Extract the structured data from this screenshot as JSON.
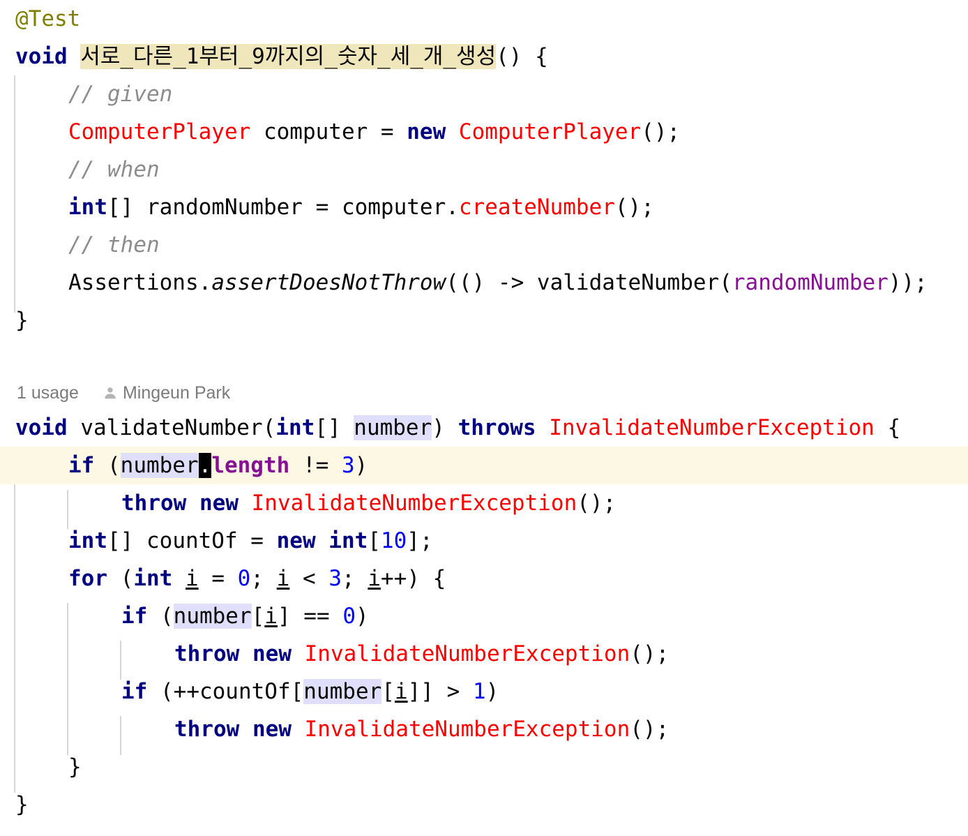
{
  "editor": {
    "language": "java",
    "theme": "IntelliJ Light",
    "colors": {
      "background": "#ffffff",
      "default_text": "#080808",
      "keyword": "#000080",
      "class_name": "#ff0000",
      "annotation": "#808000",
      "comment": "#8c8c8c",
      "number": "#0000ff",
      "instance_field": "#871094",
      "local_variable": "#871094",
      "caret_row_highlight": "#fdf8e3",
      "identifier_under_caret_highlight": "#dfdffb",
      "method_name_highlight": "#f0e6bc",
      "indent_guide": "#d7d7d7",
      "inlay_text": "#808080",
      "caret": "#000000"
    }
  },
  "code": {
    "line1": {
      "annotation": "@Test"
    },
    "line2": {
      "keyword_void": "void",
      "method_name": "서로_다른_1부터_9까지의_숫자_세_개_생성",
      "tail": "() {"
    },
    "line3": {
      "comment": "// given"
    },
    "line4": {
      "type": "ComputerPlayer",
      "var": " computer = ",
      "keyword_new": "new",
      "ctor": " ComputerPlayer",
      "tail": "();"
    },
    "line5": {
      "comment": "// when"
    },
    "line6": {
      "keyword_int": "int",
      "mid": "[] randomNumber = computer.",
      "method_call": "createNumber",
      "tail": "();"
    },
    "line7": {
      "comment": "// then"
    },
    "line8": {
      "head": "Assertions.",
      "static_method": "assertDoesNotThrow",
      "mid": "(() -> validateNumber(",
      "arg": "randomNumber",
      "tail": "));"
    },
    "line9": {
      "brace": "}"
    },
    "inlay": {
      "usages": "1 usage",
      "author": "Mingeun Park",
      "icon": "person-icon"
    },
    "line10": {
      "keyword_void": "void",
      "method_name": " validateNumber(",
      "keyword_int": "int",
      "brackets": "[] ",
      "param": "number",
      "mid": ") ",
      "keyword_throws": "throws",
      "exception": " InvalidateNumberException",
      "tail": " {"
    },
    "line11": {
      "keyword_if": "if",
      "open": " (",
      "ident": "number",
      "caret_char": ".",
      "field": "length",
      "op": " != ",
      "number": "3",
      "close": ")"
    },
    "line12": {
      "keyword_throw": "throw",
      "keyword_new": " new",
      "exception": " InvalidateNumberException",
      "tail": "();"
    },
    "line13": {
      "keyword_int": "int",
      "mid": "[] countOf = ",
      "keyword_new": "new",
      "keyword_int2": " int",
      "open": "[",
      "number": "10",
      "tail": "];"
    },
    "line14": {
      "keyword_for": "for",
      "open": " (",
      "keyword_int": "int",
      "sp1": " ",
      "var1": "i",
      "eq": " = ",
      "num0": "0",
      "semi1": "; ",
      "var2": "i",
      "lt": " < ",
      "num3": "3",
      "semi2": "; ",
      "var3": "i",
      "tail": "++) {"
    },
    "line15": {
      "keyword_if": "if",
      "open": " (",
      "ident": "number",
      "idx_open": "[",
      "var": "i",
      "idx_close": "] == ",
      "number": "0",
      "close": ")"
    },
    "line16": {
      "keyword_throw": "throw",
      "keyword_new": " new",
      "exception": " InvalidateNumberException",
      "tail": "();"
    },
    "line17": {
      "keyword_if": "if",
      "open": " (++countOf[",
      "ident": "number",
      "idx_open": "[",
      "var": "i",
      "idx_close": "]] > ",
      "number": "1",
      "close": ")"
    },
    "line18": {
      "keyword_throw": "throw",
      "keyword_new": " new",
      "exception": " InvalidateNumberException",
      "tail": "();"
    },
    "line19": {
      "brace": "}"
    },
    "line20": {
      "brace": "}"
    }
  }
}
